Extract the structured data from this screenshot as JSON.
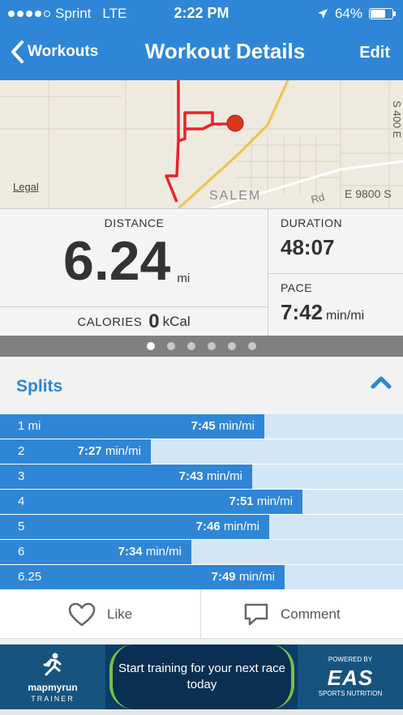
{
  "status_bar": {
    "carrier": "Sprint",
    "network": "LTE",
    "time": "2:22 PM",
    "battery": "64%"
  },
  "nav": {
    "back_label": "Workouts",
    "title": "Workout Details",
    "edit_label": "Edit"
  },
  "map": {
    "legal_label": "Legal",
    "labels": [
      "SALEM",
      "E 9800 S",
      "S 400 E",
      "Rd"
    ]
  },
  "stats": {
    "distance_label": "DISTANCE",
    "distance_value": "6.24",
    "distance_unit": "mi",
    "calories_label": "CALORIES",
    "calories_value": "0",
    "calories_unit": "kCal",
    "duration_label": "DURATION",
    "duration_value": "48:07",
    "pace_label": "PACE",
    "pace_value": "7:42",
    "pace_unit": "min/mi"
  },
  "pager": {
    "total": 6,
    "active_index": 0
  },
  "splits": {
    "title": "Splits",
    "unit": "min/mi",
    "rows": [
      {
        "label": "1 mi",
        "pace": "7:45"
      },
      {
        "label": "2",
        "pace": "7:27"
      },
      {
        "label": "3",
        "pace": "7:43"
      },
      {
        "label": "4",
        "pace": "7:51"
      },
      {
        "label": "5",
        "pace": "7:46"
      },
      {
        "label": "6",
        "pace": "7:34"
      },
      {
        "label": "6.25",
        "pace": "7:49"
      }
    ]
  },
  "actions": {
    "like_label": "Like",
    "comment_label": "Comment"
  },
  "ad": {
    "brand": "mapmyrun",
    "brand_sub": "TRAINER",
    "message": "Start training for your next race today",
    "powered_by": "POWERED BY",
    "sponsor": "EAS",
    "sponsor_sub": "SPORTS NUTRITION"
  }
}
